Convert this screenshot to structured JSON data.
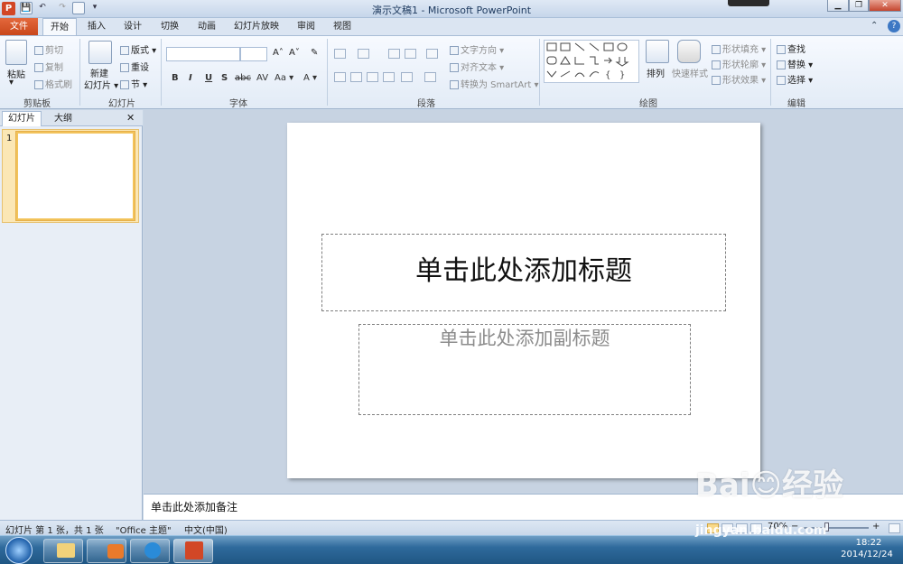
{
  "window": {
    "title": "演示文稿1 - Microsoft PowerPoint",
    "logo": "P"
  },
  "quick_access": {
    "save": "💾",
    "undo": "↶",
    "redo": "↷",
    "more": "▾"
  },
  "controls": {
    "minimize": "▁",
    "maximize": "❐",
    "close": "✕",
    "ribbon_min": "⌃",
    "help": "?"
  },
  "tabs": {
    "file": "文件",
    "items": [
      "开始",
      "插入",
      "设计",
      "切换",
      "动画",
      "幻灯片放映",
      "审阅",
      "视图"
    ]
  },
  "ribbon": {
    "clipboard": {
      "paste": "粘贴",
      "cut": "剪切",
      "copy": "复制",
      "format_painter": "格式刷",
      "label": "剪贴板"
    },
    "slides": {
      "new_slide_1": "新建",
      "new_slide_2": "幻灯片 ▾",
      "layout": "版式 ▾",
      "reset": "重设",
      "section": "节 ▾",
      "label": "幻灯片"
    },
    "font": {
      "grow": "A˄",
      "shrink": "A˅",
      "clear": "✎",
      "bold": "B",
      "italic": "I",
      "underline": "U",
      "shadow": "S",
      "strike": "abc",
      "spacing": "AV",
      "case": "Aa ▾",
      "color": "A ▾",
      "label": "字体"
    },
    "paragraph": {
      "text_direction": "文字方向 ▾",
      "align_text": "对齐文本 ▾",
      "smartart": "转换为 SmartArt ▾",
      "label": "段落"
    },
    "drawing": {
      "arrange": "排列",
      "quick_styles": "快速样式",
      "shape_fill": "形状填充 ▾",
      "shape_outline": "形状轮廓 ▾",
      "shape_effects": "形状效果 ▾",
      "label": "绘图"
    },
    "editing": {
      "find": "查找",
      "replace": "替换 ▾",
      "select": "选择 ▾",
      "label": "编辑"
    }
  },
  "left_panel": {
    "tab_slides": "幻灯片",
    "tab_outline": "大纲",
    "close": "✕",
    "slide_number": "1"
  },
  "slide": {
    "title_placeholder": "单击此处添加标题",
    "subtitle_placeholder": "单击此处添加副标题"
  },
  "notes": {
    "placeholder": "单击此处添加备注"
  },
  "status": {
    "slide_info": "幻灯片 第 1 张，共 1 张",
    "theme": "\"Office 主题\"",
    "language": "中文(中国)",
    "zoom": "70%",
    "zoom_minus": "−",
    "zoom_plus": "+"
  },
  "taskbar": {
    "time": "18:22",
    "date": "2014/12/24"
  },
  "watermark": {
    "text": "Bai😊经验",
    "url": "jingyan.baidu.com"
  }
}
